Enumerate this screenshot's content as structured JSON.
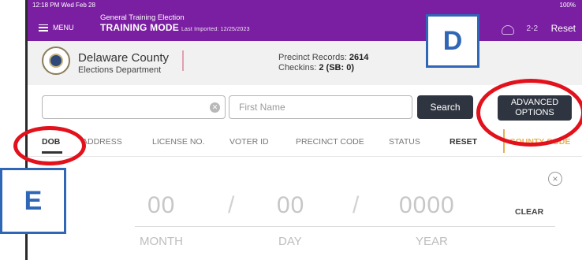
{
  "status": {
    "time": "12:18 PM  Wed Feb 28",
    "battery": "100%"
  },
  "topbar": {
    "menu_label": "MENU",
    "election_name": "General Training Election",
    "mode": "TRAINING MODE",
    "last_imported": "Last Imported: 12/25/2023",
    "reset_label": "Reset",
    "people_icon": "2-2"
  },
  "header": {
    "county": "Delaware County",
    "department": "Elections Department",
    "records_label": "Precinct Records:",
    "records_value": "2614",
    "checkins_label": "Checkins:",
    "checkins_value": "2 (SB: 0)"
  },
  "search": {
    "last_name_placeholder": "",
    "first_name_placeholder": "First Name",
    "search_label": "Search",
    "advanced_line1": "ADVANCED",
    "advanced_line2": "OPTIONS"
  },
  "tabs": {
    "dob": "DOB",
    "address": "ADDRESS",
    "license": "LICENSE NO.",
    "voter_id": "VOTER ID",
    "precinct": "PRECINCT CODE",
    "status": "STATUS",
    "reset": "RESET",
    "cut": "COUNTY CODE"
  },
  "dob": {
    "month": "00",
    "day": "00",
    "year": "0000",
    "slash": "/",
    "clear": "CLEAR",
    "month_label": "MONTH",
    "day_label": "DAY",
    "year_label": "YEAR",
    "close": "×"
  },
  "callouts": {
    "d": "D",
    "e": "E"
  },
  "colors": {
    "topbar": "#7b1fa2",
    "accent_blue": "#2f66b6",
    "highlight_red": "#e2111c",
    "button_dark": "#2f3540",
    "gold": "#e7b24e"
  }
}
